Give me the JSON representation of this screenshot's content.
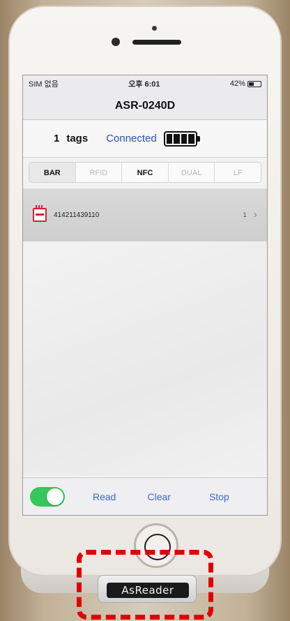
{
  "status_bar": {
    "carrier": "SIM 없음",
    "time": "오후 6:01",
    "battery": "42%"
  },
  "title": "ASR-0240D",
  "tag_bar": {
    "count": "1",
    "label": "tags",
    "connection": "Connected",
    "battery_level": 1.0
  },
  "tabs": [
    {
      "label": "BAR",
      "selected": true
    },
    {
      "label": "RFID",
      "selected": false
    },
    {
      "label": "NFC",
      "selected": false
    },
    {
      "label": "DUAL",
      "selected": false
    },
    {
      "label": "LF",
      "selected": false
    }
  ],
  "tags": [
    {
      "value": "414211439110",
      "count": "1",
      "icon": "barcode-tag-icon"
    }
  ],
  "toolbar": {
    "toggle_on": true,
    "read": "Read",
    "clear": "Clear",
    "stop": "Stop"
  },
  "reader_badge": "AsReader",
  "colors": {
    "accent": "#3768d6",
    "toggle": "#34c759",
    "tag_icon": "#d6203a",
    "highlight": "#e10000"
  }
}
